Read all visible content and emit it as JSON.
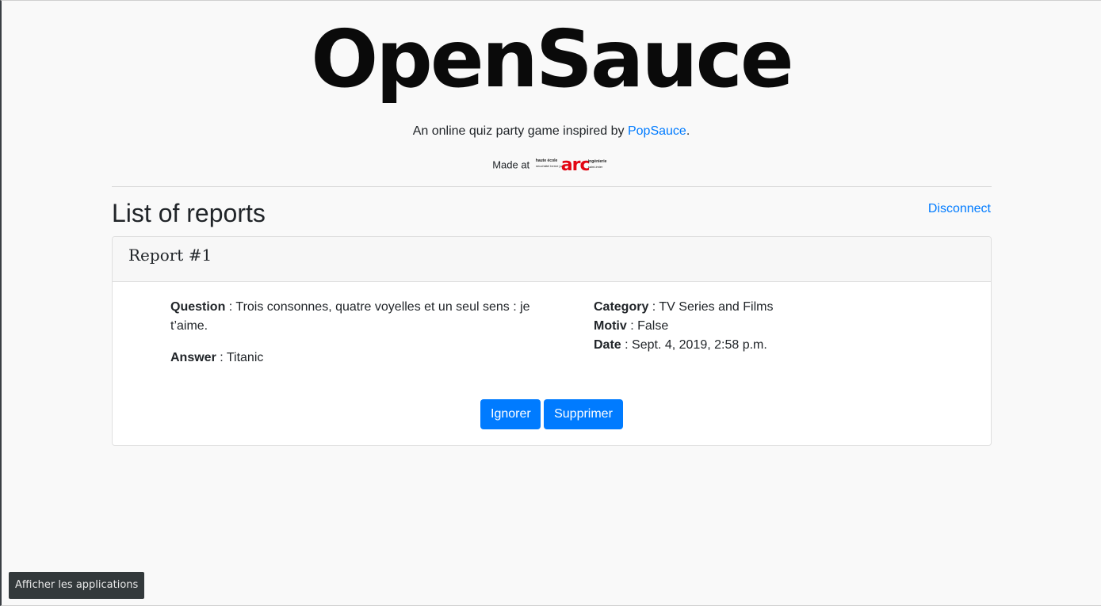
{
  "brand": {
    "title": "OpenSauce",
    "tagline_prefix": "An online quiz party game inspired by ",
    "tagline_link": "PopSauce",
    "tagline_suffix": ".",
    "made_at": "Made at",
    "logo_text": {
      "top_left": "haute école",
      "bottom_left": "neuchâtel berne jura",
      "main": "arc",
      "top_right": "ingénierie",
      "bottom_right": "saint-imier"
    }
  },
  "page": {
    "heading": "List of reports",
    "disconnect_label": "Disconnect"
  },
  "report": {
    "title": "Report #1",
    "question_label": "Question",
    "question_value": "Trois consonnes, quatre voyelles et un seul sens : je t’aime.",
    "answer_label": "Answer",
    "answer_value": "Titanic",
    "category_label": "Category",
    "category_value": "TV Series and Films",
    "motiv_label": "Motiv",
    "motiv_value": "False",
    "date_label": "Date",
    "date_value": "Sept. 4, 2019, 2:58 p.m.",
    "separator": " : ",
    "ignore_label": "Ignorer",
    "delete_label": "Supprimer"
  },
  "system": {
    "tooltip": "Afficher les applications"
  },
  "colors": {
    "link": "#007bff",
    "button": "#007bff",
    "logo_red": "#e30613"
  }
}
